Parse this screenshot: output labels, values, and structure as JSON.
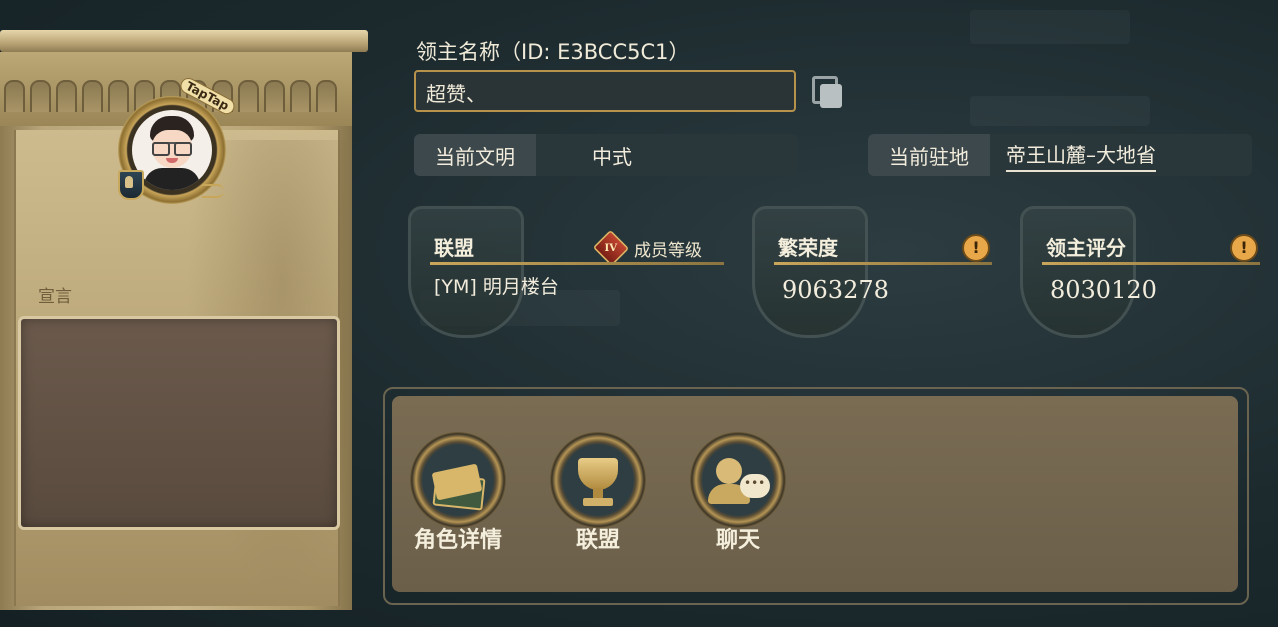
{
  "lord": {
    "name_title": "领主名称（ID: E3BCC5C1）",
    "name_value": "超赞、",
    "copy_icon": "copy-icon"
  },
  "civilization": {
    "label": "当前文明",
    "value": "中式"
  },
  "station": {
    "label": "当前驻地",
    "value": "帝王山麓–大地省"
  },
  "alliance": {
    "label": "联盟",
    "rank_badge": "IV",
    "rank_label": "成员等级",
    "value": "[YM] 明月楼台"
  },
  "prosperity": {
    "label": "繁荣度",
    "value": "9063278",
    "info_icon": "alert-icon"
  },
  "score": {
    "label": "领主评分",
    "value": "8030120",
    "info_icon": "alert-icon"
  },
  "profile": {
    "badge": "TapTap",
    "declaration_label": "宣言",
    "declaration_text": ""
  },
  "actions": [
    {
      "label": "角色详情",
      "icon": "cards-icon"
    },
    {
      "label": "联盟",
      "icon": "trophy-icon"
    },
    {
      "label": "聊天",
      "icon": "chat-icon"
    }
  ],
  "colors": {
    "gold_accent": "#b6924b",
    "panel_bg": "#29363a",
    "alert": "#e8a84a"
  }
}
